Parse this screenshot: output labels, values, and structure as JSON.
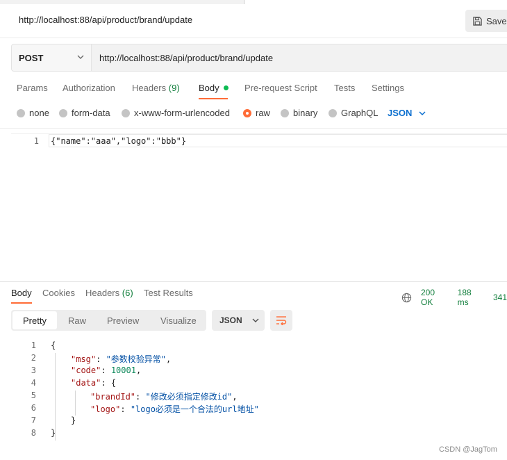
{
  "request": {
    "title": "http://localhost:88/api/product/brand/update",
    "save_label": "Save",
    "method": "POST",
    "url": "http://localhost:88/api/product/brand/update"
  },
  "tabs": [
    {
      "label": "Params"
    },
    {
      "label": "Authorization"
    },
    {
      "label": "Headers",
      "count": "(9)"
    },
    {
      "label": "Body",
      "active": true
    },
    {
      "label": "Pre-request Script"
    },
    {
      "label": "Tests"
    },
    {
      "label": "Settings"
    }
  ],
  "body_types": [
    {
      "label": "none"
    },
    {
      "label": "form-data"
    },
    {
      "label": "x-www-form-urlencoded"
    },
    {
      "label": "raw",
      "selected": true
    },
    {
      "label": "binary"
    },
    {
      "label": "GraphQL"
    }
  ],
  "body_format": "JSON",
  "request_body": {
    "line_number": "1",
    "text": "{\"name\":\"aaa\",\"logo\":\"bbb\"}"
  },
  "response": {
    "tabs": [
      {
        "label": "Body",
        "active": true
      },
      {
        "label": "Cookies"
      },
      {
        "label": "Headers",
        "count": "(6)"
      },
      {
        "label": "Test Results"
      }
    ],
    "status": "200 OK",
    "time": "188 ms",
    "size": "341",
    "views": [
      "Pretty",
      "Raw",
      "Preview",
      "Visualize"
    ],
    "active_view": "Pretty",
    "format": "JSON",
    "lines": [
      {
        "n": "1",
        "text": "{"
      },
      {
        "n": "2",
        "key": "\"msg\"",
        "value": "\"参数校验异常\"",
        "type": "string",
        "tail": ","
      },
      {
        "n": "3",
        "key": "\"code\"",
        "value": "10001",
        "type": "number",
        "tail": ","
      },
      {
        "n": "4",
        "key": "\"data\"",
        "value": "{",
        "type": "brace",
        "tail": ""
      },
      {
        "n": "5",
        "key": "\"brandId\"",
        "value": "\"修改必须指定修改id\"",
        "type": "string",
        "tail": ","
      },
      {
        "n": "6",
        "key": "\"logo\"",
        "value": "\"logo必须是一个合法的url地址\"",
        "type": "string",
        "tail": ""
      },
      {
        "n": "7",
        "text": "}"
      },
      {
        "n": "8",
        "text": "}"
      }
    ]
  },
  "watermark": "CSDN @JagTom",
  "colors": {
    "accent": "#ff6c37",
    "status_ok": "#0f7d3a",
    "link_blue": "#0b6fcf"
  }
}
